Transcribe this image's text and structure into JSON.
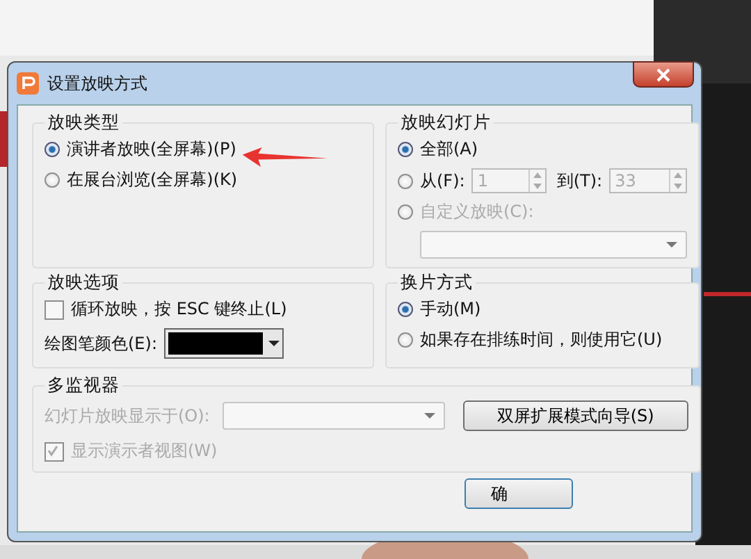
{
  "window": {
    "title": "设置放映方式"
  },
  "show_type": {
    "title": "放映类型",
    "options": [
      {
        "label": "演讲者放映(全屏幕)(P)",
        "selected": true,
        "disabled": false
      },
      {
        "label": "在展台浏览(全屏幕)(K)",
        "selected": false,
        "disabled": false
      }
    ]
  },
  "slides": {
    "title": "放映幻灯片",
    "options": [
      {
        "kind": "plain",
        "label": "全部(A)",
        "selected": true,
        "disabled": false
      },
      {
        "kind": "range",
        "label": "从(F):",
        "selected": false,
        "disabled": false,
        "from": "1",
        "to_label": "到(T):",
        "to": "33"
      },
      {
        "kind": "custom",
        "label": "自定义放映(C):",
        "selected": false,
        "disabled": true
      }
    ]
  },
  "options": {
    "title": "放映选项",
    "loop": {
      "label": "循环放映，按 ESC 键终止(L)",
      "checked": false
    },
    "pen": {
      "label": "绘图笔颜色(E):",
      "color": "#000000"
    }
  },
  "advance": {
    "title": "换片方式",
    "options": [
      {
        "label": "手动(M)",
        "selected": true,
        "disabled": false
      },
      {
        "label": "如果存在排练时间，则使用它(U)",
        "selected": false,
        "disabled": false
      }
    ]
  },
  "monitors": {
    "title": "多监视器",
    "display_label": "幻灯片放映显示于(O):",
    "display_disabled": true,
    "wizard_button": "双屏扩展模式向导(S)",
    "presenter": {
      "label": "显示演示者视图(W)",
      "checked": true,
      "disabled": true
    }
  },
  "buttons": [
    "确"
  ]
}
